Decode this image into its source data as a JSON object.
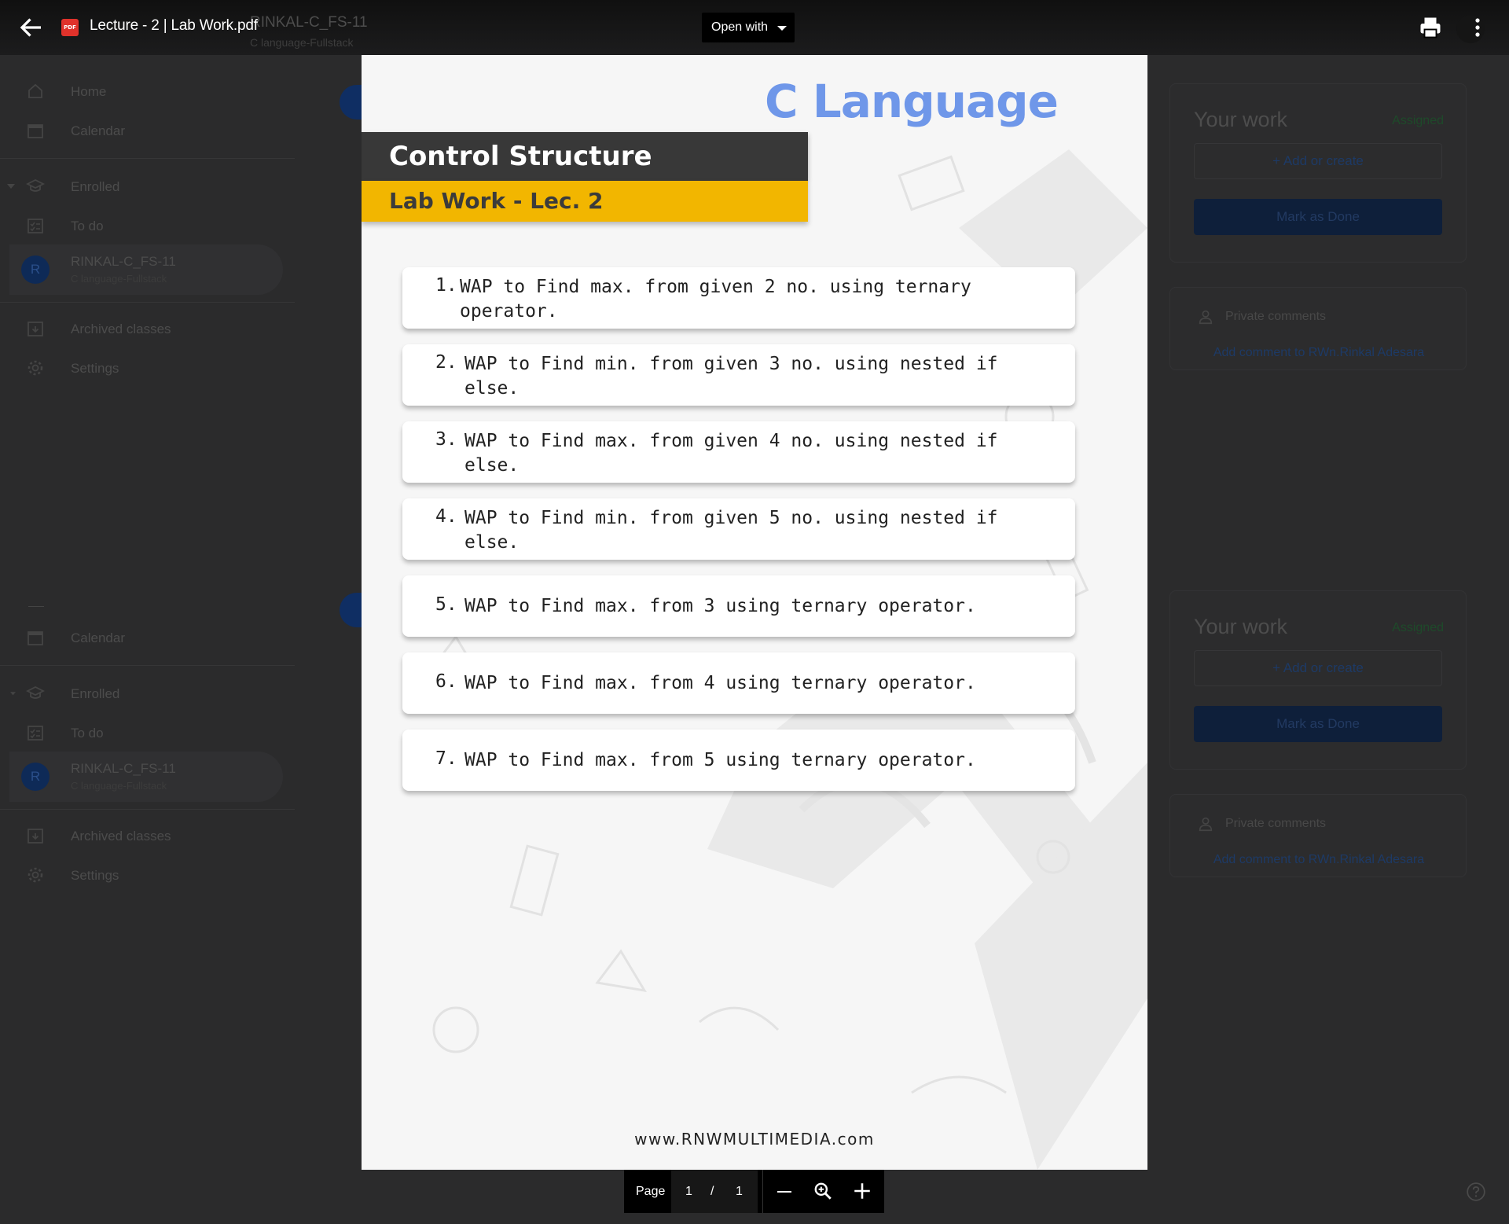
{
  "topbar": {
    "file_title": "Lecture - 2 | Lab Work.pdf",
    "file_type_badge": "PDF",
    "open_with_label": "Open with",
    "bg_class_title": "RINKAL-C_FS-11",
    "bg_class_sub": "C language-Fullstack"
  },
  "sidebar_top": {
    "home": "Home",
    "calendar": "Calendar",
    "enrolled": "Enrolled",
    "todo": "To do",
    "class_initial": "R",
    "class_name": "RINKAL-C_FS-11",
    "class_sub": "C language-Fullstack",
    "archived": "Archived classes",
    "settings": "Settings"
  },
  "sidebar_bottom": {
    "calendar": "Calendar",
    "enrolled": "Enrolled",
    "todo": "To do",
    "class_initial": "R",
    "class_name": "RINKAL-C_FS-11",
    "class_sub": "C language-Fullstack",
    "archived": "Archived classes",
    "settings": "Settings"
  },
  "work_card_1": {
    "title": "Your work",
    "status": "Assigned",
    "add_label": "Add or create",
    "mark_label": "Mark as Done",
    "private_comments": "Private comments",
    "add_comment": "Add comment to RWn.Rinkal Adesara"
  },
  "work_card_2": {
    "title": "Your work",
    "status": "Assigned",
    "add_label": "Add or create",
    "mark_label": "Mark as Done",
    "private_comments": "Private comments",
    "add_comment": "Add comment to RWn.Rinkal Adesara"
  },
  "document": {
    "brand_title": "C Language",
    "heading": "Control Structure",
    "subheading": "Lab Work - Lec. 2",
    "tasks": [
      {
        "num": "1.",
        "text": "WAP to Find max. from given 2 no. using ternary operator."
      },
      {
        "num": "2.",
        "text": "WAP to Find min. from given 3 no. using nested if else."
      },
      {
        "num": "3.",
        "text": "WAP to Find max. from given 4 no. using nested if else."
      },
      {
        "num": "4.",
        "text": "WAP to Find min. from given 5 no. using nested if else."
      },
      {
        "num": "5.",
        "text": "WAP to Find max. from 3 using ternary operator."
      },
      {
        "num": "6.",
        "text": "WAP to Find max. from 4 using ternary operator."
      },
      {
        "num": "7.",
        "text": "WAP to Find max. from 5 using ternary operator."
      }
    ],
    "website": "www.RNWMULTIMEDIA.com"
  },
  "pager": {
    "page_label": "Page",
    "current": "1",
    "separator": "/",
    "total": "1"
  },
  "icons": {
    "back": "arrow-left-icon",
    "print": "printer-icon",
    "more": "more-vert-icon",
    "zoom_out": "minus-icon",
    "zoom": "zoom-icon",
    "zoom_in": "plus-icon",
    "help": "help-icon"
  },
  "colors": {
    "brand_blue": "#6f97e9",
    "band_dark": "#383838",
    "band_yellow": "#f2b600",
    "overlay": "#2b2b2c"
  }
}
